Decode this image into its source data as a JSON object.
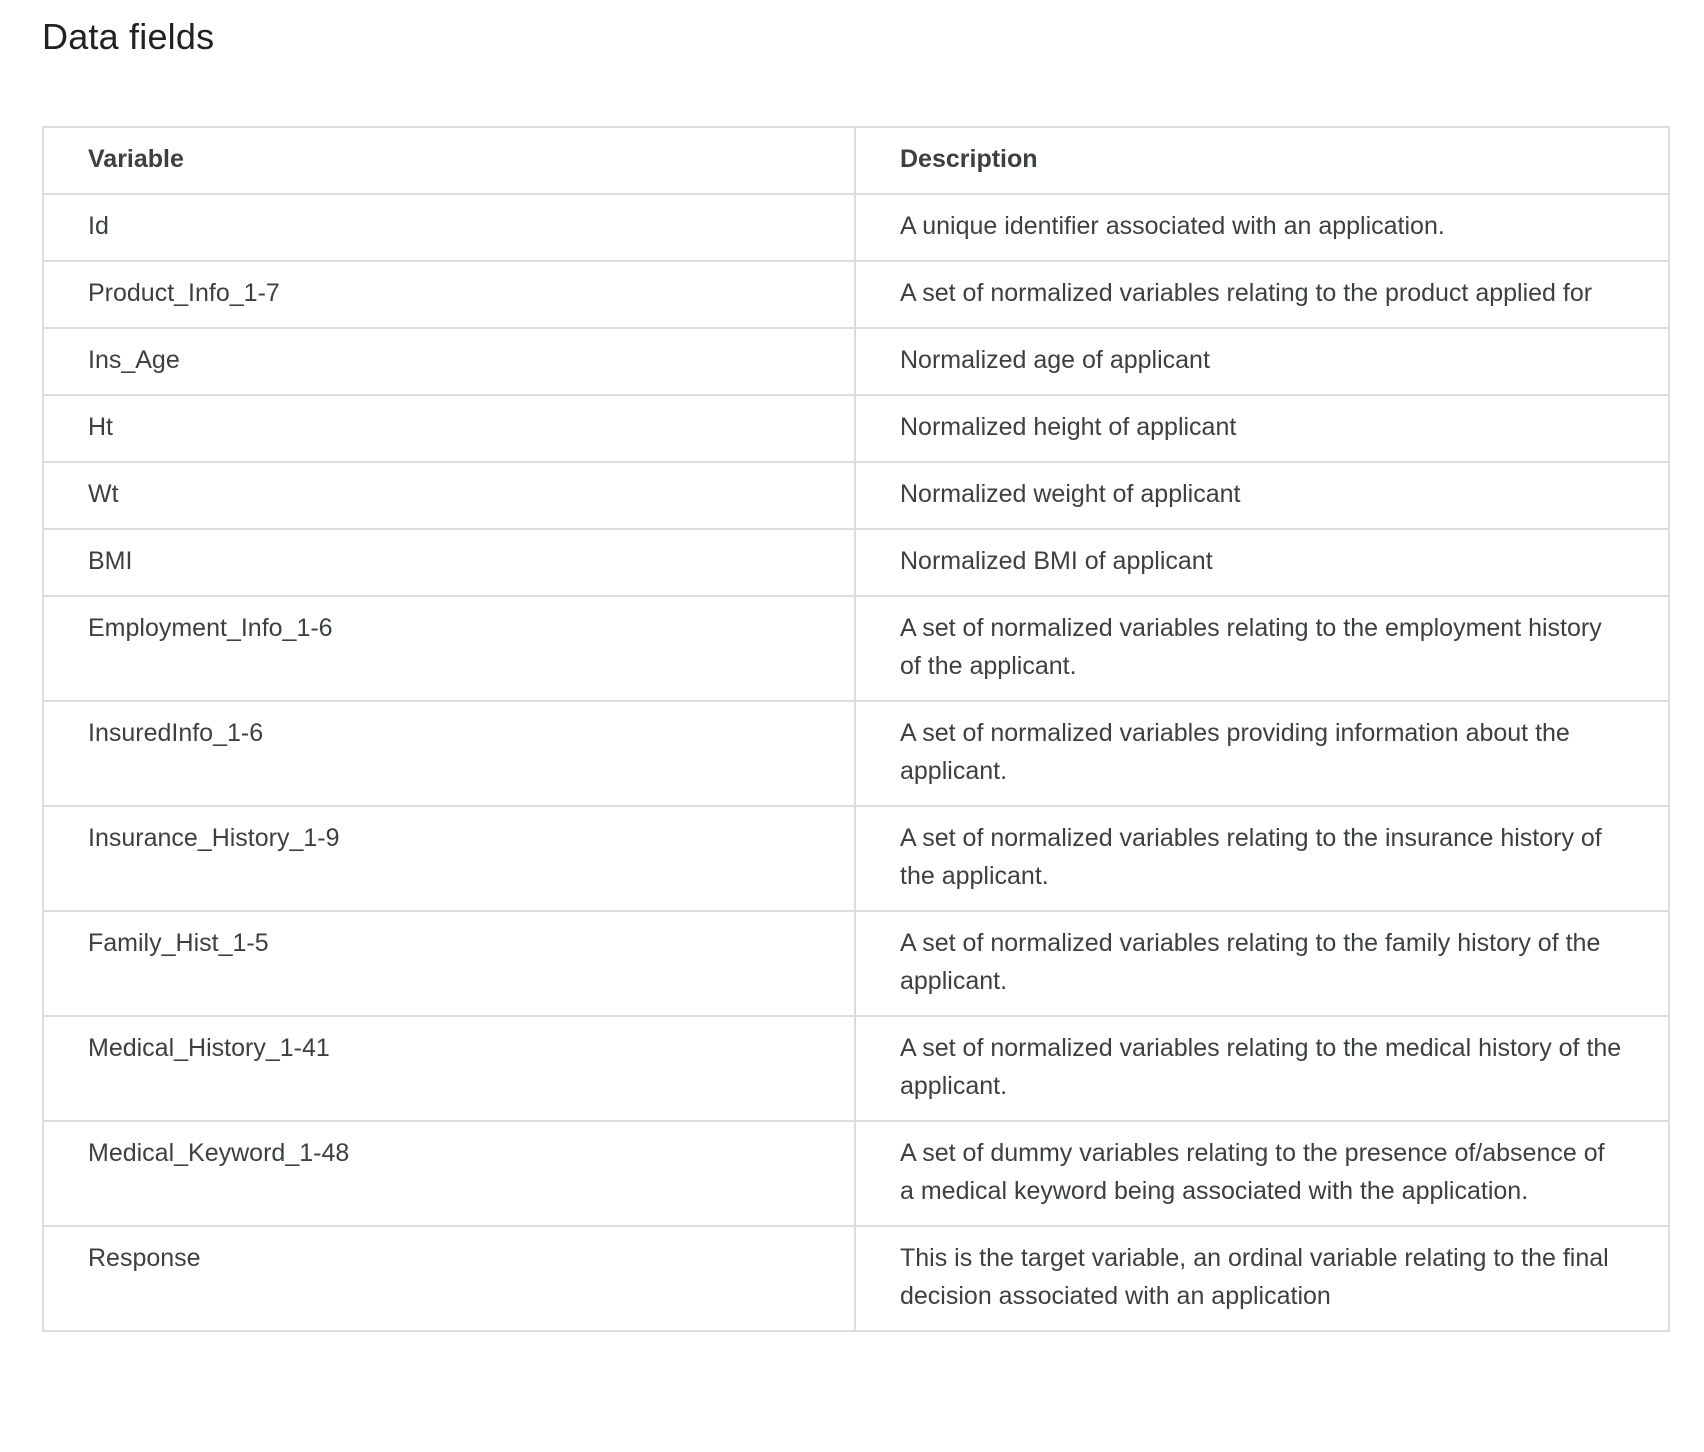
{
  "page": {
    "title": "Data fields"
  },
  "table": {
    "headers": [
      "Variable",
      "Description"
    ],
    "rows": [
      [
        "Id",
        "A unique identifier associated with an application."
      ],
      [
        "Product_Info_1-7",
        "A set of normalized variables relating to the product applied for"
      ],
      [
        "Ins_Age",
        "Normalized age of applicant"
      ],
      [
        "Ht",
        "Normalized height of applicant"
      ],
      [
        "Wt",
        "Normalized weight of applicant"
      ],
      [
        "BMI",
        "Normalized BMI of applicant"
      ],
      [
        "Employment_Info_1-6",
        "A set of normalized variables relating to the employment history of the applicant."
      ],
      [
        "InsuredInfo_1-6",
        "A set of normalized variables providing information about the applicant."
      ],
      [
        "Insurance_History_1-9",
        "A set of normalized variables relating to the insurance history of the applicant."
      ],
      [
        "Family_Hist_1-5",
        "A set of normalized variables relating to the family history of the applicant."
      ],
      [
        "Medical_History_1-41",
        "A set of normalized variables relating to the medical history of the applicant."
      ],
      [
        "Medical_Keyword_1-48",
        "A set of dummy variables relating to the presence of/absence of a medical keyword being associated with the application."
      ],
      [
        "Response",
        "This is the target variable, an ordinal variable relating to the final decision associated with an application"
      ]
    ]
  }
}
